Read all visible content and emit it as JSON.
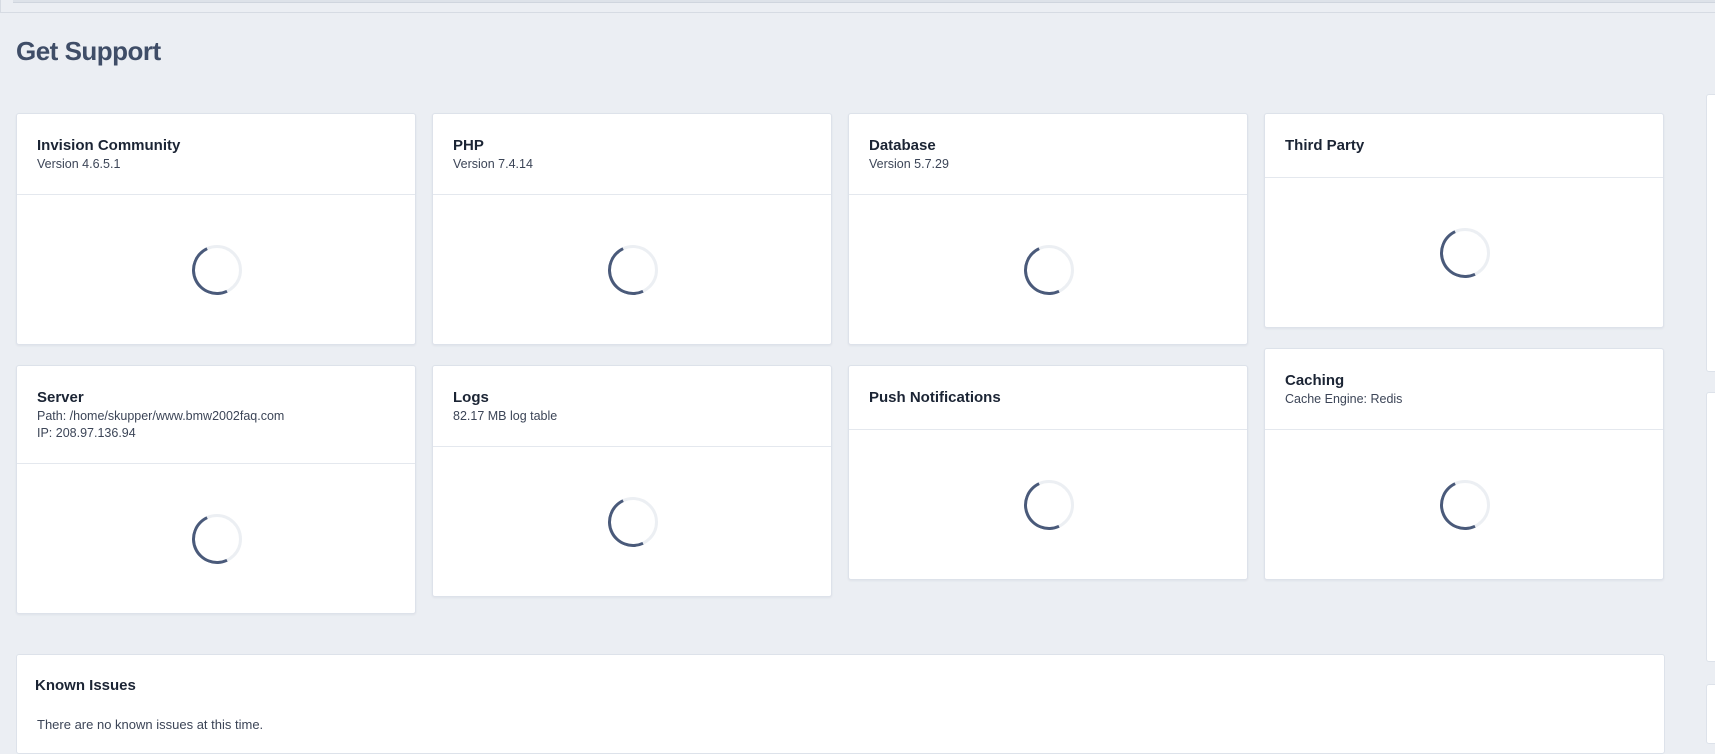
{
  "page": {
    "title": "Get Support"
  },
  "cards": [
    {
      "title": "Invision Community",
      "lines": [
        "Version 4.6.5.1"
      ]
    },
    {
      "title": "PHP",
      "lines": [
        "Version 7.4.14"
      ]
    },
    {
      "title": "Database",
      "lines": [
        "Version 5.7.29"
      ]
    },
    {
      "title": "Third Party",
      "lines": []
    },
    {
      "title": "Server",
      "lines": [
        "Path: /home/skupper/www.bmw2002faq.com",
        "IP: 208.97.136.94"
      ]
    },
    {
      "title": "Logs",
      "lines": [
        "82.17 MB log table"
      ]
    },
    {
      "title": "Push Notifications",
      "lines": []
    },
    {
      "title": "Caching",
      "lines": [
        "Cache Engine: Redis"
      ]
    }
  ],
  "known_issues": {
    "title": "Known Issues",
    "message": "There are no known issues at this time."
  },
  "colors": {
    "background": "#ebeef3",
    "title": "#3f4d67",
    "spinner": "#4a5a7a"
  }
}
